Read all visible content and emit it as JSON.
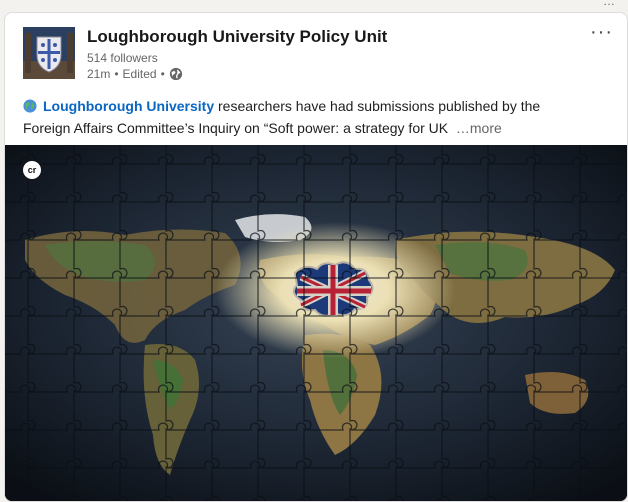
{
  "top_cut_text": "…",
  "post": {
    "actor_name": "Loughborough University Policy Unit",
    "followers": "514 followers",
    "time": "21m",
    "edited": "Edited",
    "sep1": "•",
    "sep2": "•",
    "mention": "Loughborough University",
    "text_line1": " researchers have had submissions published by the",
    "text_line2": "Foreign Affairs Committee’s Inquiry on “Soft power: a strategy for UK",
    "see_more": "…more",
    "media_badge": "cr"
  },
  "colors": {
    "mention": "#0a66c2",
    "text": "#1f1f1f",
    "subtle": "#666666"
  }
}
